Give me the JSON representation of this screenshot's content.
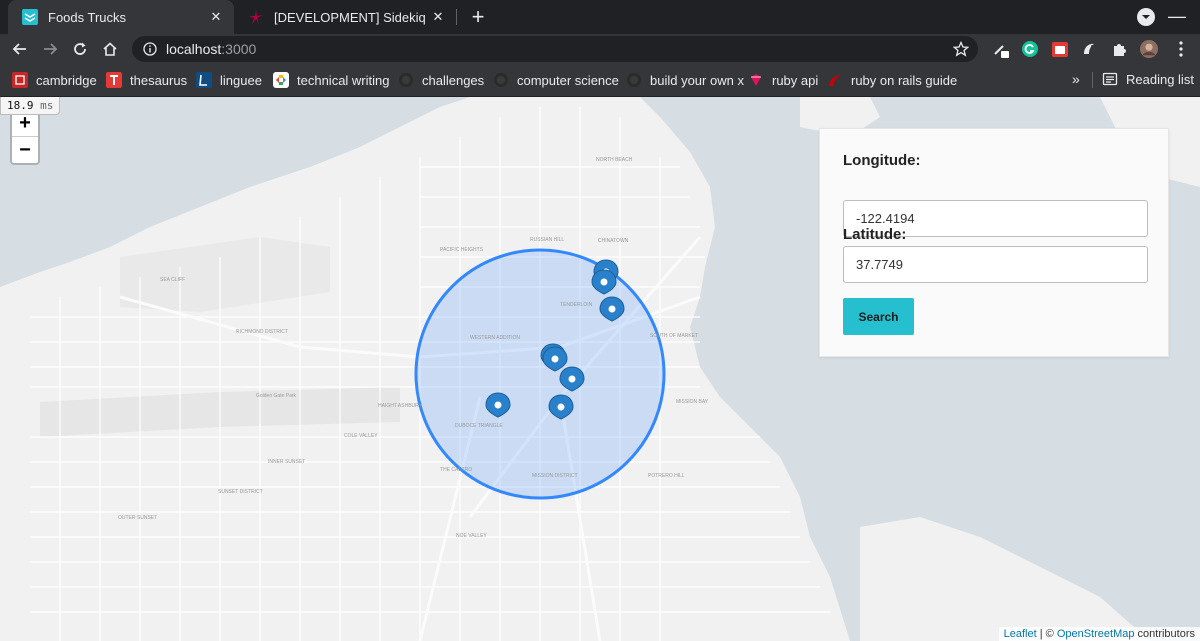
{
  "tabs": [
    {
      "title": "Foods Trucks",
      "active": true,
      "favicon": "foods-trucks-favicon-icon"
    },
    {
      "title": "[DEVELOPMENT] Sidekiq",
      "active": false,
      "favicon": "sidekiq-favicon-icon"
    }
  ],
  "toolbar": {
    "url_host": "localhost",
    "url_port": ":3000"
  },
  "bookmarks": [
    {
      "label": "cambridge",
      "icon": "cambridge-icon"
    },
    {
      "label": "thesaurus",
      "icon": "thesaurus-icon"
    },
    {
      "label": "linguee",
      "icon": "linguee-icon"
    },
    {
      "label": "technical writing",
      "icon": "google-docs-icon"
    },
    {
      "label": "challenges",
      "icon": "github-icon"
    },
    {
      "label": "computer science",
      "icon": "github-icon"
    },
    {
      "label": "build your own x",
      "icon": "github-icon"
    },
    {
      "label": "ruby api",
      "icon": "ruby-icon"
    },
    {
      "label": "ruby on rails guide",
      "icon": "rails-icon"
    }
  ],
  "bookmarks_more": "»",
  "reading_list": "Reading list",
  "perf": {
    "value": "18.9",
    "unit": "ms"
  },
  "zoom": {
    "in": "+",
    "out": "−"
  },
  "form": {
    "longitude_label": "Longitude:",
    "longitude_value": "-122.4194",
    "latitude_label": "Latitude:",
    "latitude_value": "37.7749",
    "search_label": "Search"
  },
  "attribution": {
    "leaflet": "Leaflet",
    "separator": " | © ",
    "osm": "OpenStreetMap",
    "suffix": " contributors"
  },
  "map_labels": {
    "north_beach": "NORTH BEACH",
    "chinatown": "CHINATOWN",
    "russian_hill": "RUSSIAN HILL",
    "pacific_heights": "PACIFIC HEIGHTS",
    "western_addition": "WESTERN ADDITION",
    "tenderloin": "TENDERLOIN",
    "south_of_market": "SOUTH OF MARKET",
    "mission_bay": "MISSION BAY",
    "mission_district": "MISSION DISTRICT",
    "haight_ashbury": "HAIGHT ASHBURY",
    "inner_sunset": "INNER SUNSET",
    "outer_sunset": "OUTER SUNSET",
    "sunset_district": "SUNSET DISTRICT",
    "richmond_district": "RICHMOND DISTRICT",
    "sea_cliff": "SEA CLIFF",
    "potrero_hill": "POTRERO HILL",
    "noe_valley": "NOE VALLEY",
    "duboce_triangle": "DUBOCE TRIANGLE",
    "the_castro": "THE CASTRO",
    "cole_valley": "COLE VALLEY",
    "golden_gate_park": "Golden Gate Park"
  },
  "map": {
    "circle_color": "#3388ff",
    "marker_color": "#2a81cb",
    "marker_count": 8
  }
}
